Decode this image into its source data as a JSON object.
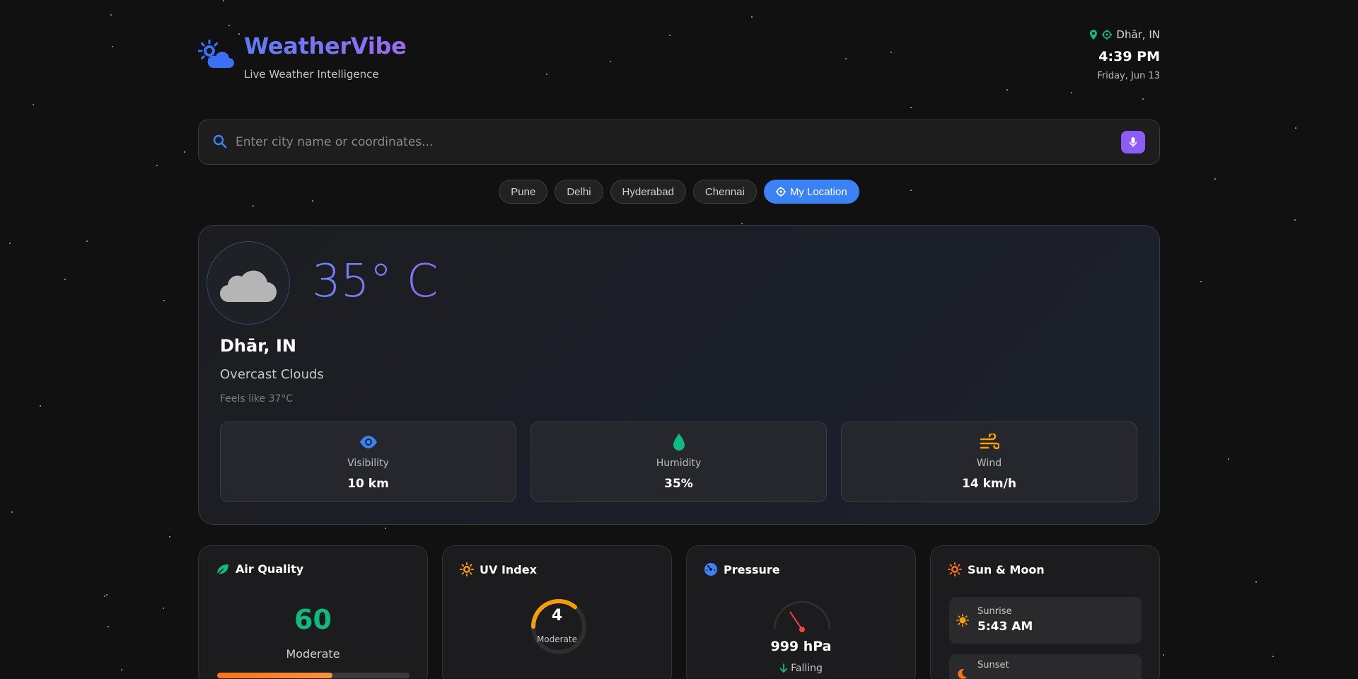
{
  "app": {
    "name": "WeatherVibe",
    "tagline": "Live Weather Intelligence"
  },
  "header": {
    "location": "Dhār, IN",
    "time": "4:39 PM",
    "date": "Friday, Jun 13"
  },
  "search": {
    "placeholder": "Enter city name or coordinates..."
  },
  "quick_cities": [
    {
      "label": "Pune"
    },
    {
      "label": "Delhi"
    },
    {
      "label": "Hyderabad"
    },
    {
      "label": "Chennai"
    },
    {
      "label": "My Location",
      "active": true
    }
  ],
  "current": {
    "temperature": "35° C",
    "city": "Dhār, IN",
    "condition": "Overcast Clouds",
    "feels_like": "Feels like 37°C",
    "icon": "cloud-icon",
    "stats": [
      {
        "label": "Visibility",
        "value": "10 km",
        "icon": "eye-icon"
      },
      {
        "label": "Humidity",
        "value": "35%",
        "icon": "droplet-icon"
      },
      {
        "label": "Wind",
        "value": "14 km/h",
        "icon": "wind-icon"
      }
    ]
  },
  "air_quality": {
    "title": "Air Quality",
    "value": "60",
    "label": "Moderate",
    "level": 0.6
  },
  "uv_index": {
    "title": "UV Index",
    "value": "4",
    "label": "Moderate",
    "level": 0.36
  },
  "pressure": {
    "title": "Pressure",
    "value": "999 hPa",
    "trend": "Falling"
  },
  "sun_moon": {
    "title": "Sun & Moon",
    "sunrise_label": "Sunrise",
    "sunrise": "5:43 AM",
    "sunset_label": "Sunset"
  },
  "colors": {
    "accent": "#3b82f6",
    "brand_start": "#5b7cf6",
    "brand_end": "#9b6cf0",
    "aqi": "#10b981",
    "uv": "#f59e0b",
    "mic": "#8b5cf6"
  }
}
